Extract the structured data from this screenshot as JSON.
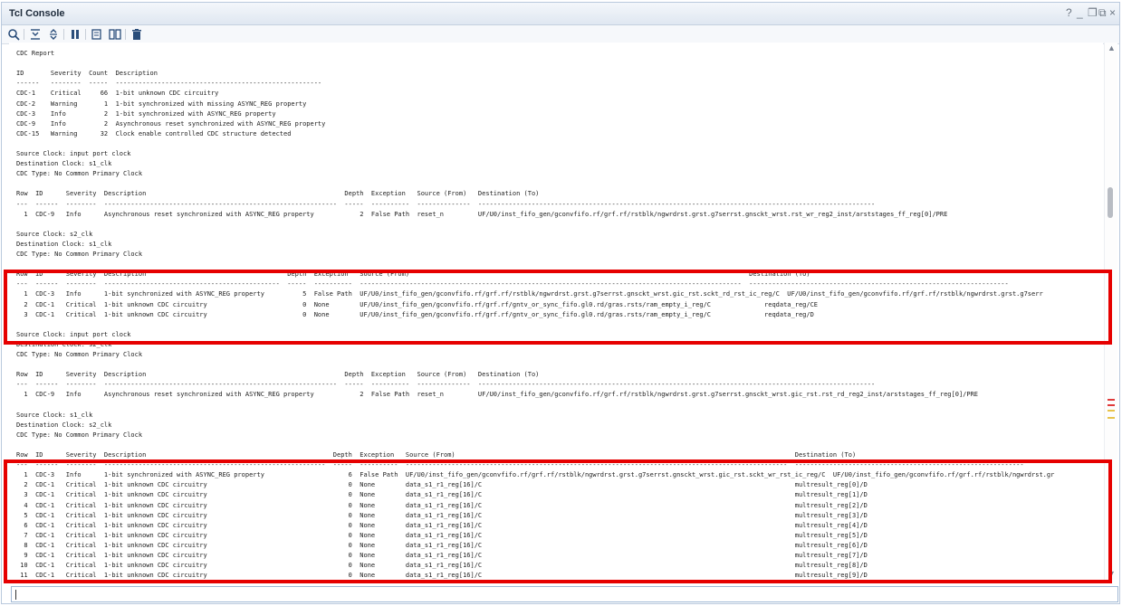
{
  "window": {
    "title": "Tcl Console",
    "controls": [
      "?",
      "_",
      "❐",
      "⧉",
      "×"
    ]
  },
  "toolbar": {
    "buttons": [
      {
        "icon": "search-icon"
      },
      {
        "icon": "collapse-all-icon"
      },
      {
        "icon": "expand-all-icon"
      },
      {
        "icon": "pause-icon"
      },
      {
        "icon": "copy-icon"
      },
      {
        "icon": "columns-icon"
      },
      {
        "icon": "delete-icon"
      }
    ]
  },
  "console": {
    "lines": [
      "CDC Report",
      "",
      "ID       Severity  Count  Description",
      "------   --------  -----  ------------------------------------------------------",
      "CDC-1    Critical     66  1-bit unknown CDC circuitry",
      "CDC-2    Warning       1  1-bit synchronized with missing ASYNC_REG property",
      "CDC-3    Info          2  1-bit synchronized with ASYNC_REG property",
      "CDC-9    Info          2  Asynchronous reset synchronized with ASYNC_REG property",
      "CDC-15   Warning      32  Clock enable controlled CDC structure detected",
      "",
      "Source Clock: input port clock",
      "Destination Clock: s1_clk",
      "CDC Type: No Common Primary Clock",
      "",
      "Row  ID      Severity  Description                                                    Depth  Exception   Source (From)   Destination (To)",
      "---  ------  --------  -------------------------------------------------------------  -----  ----------  --------------  --------------------------------------------------------------------------------------------------------",
      "  1  CDC-9   Info      Asynchronous reset synchronized with ASYNC_REG property            2  False Path  reset_n         UF/U0/inst_fifo_gen/gconvfifo.rf/grf.rf/rstblk/ngwrdrst.grst.g7serrst.gnsckt_wrst.rst_wr_reg2_inst/arststages_ff_reg[0]/PRE",
      "",
      "Source Clock: s2_clk",
      "Destination Clock: s1_clk",
      "CDC Type: No Common Primary Clock",
      "",
      "Row  ID      Severity  Description                                     Depth  Exception   Source (From)                                                                                         Destination (To)",
      "---  ------  --------  ----------------------------------------------  -----  ----------  ----------------------------------------------------------------------------------------------------  --------------------------------------------------------------------",
      "  1  CDC-3   Info      1-bit synchronized with ASYNC_REG property          5  False Path  UF/U0/inst_fifo_gen/gconvfifo.rf/grf.rf/rstblk/ngwrdrst.grst.g7serrst.gnsckt_wrst.gic_rst.sckt_rd_rst_ic_reg/C  UF/U0/inst_fifo_gen/gconvfifo.rf/grf.rf/rstblk/ngwrdrst.grst.g7serr",
      "  2  CDC-1   Critical  1-bit unknown CDC circuitry                         0  None        UF/U0/inst_fifo_gen/gconvfifo.rf/grf.rf/gntv_or_sync_fifo.gl0.rd/gras.rsts/ram_empty_i_reg/C              reqdata_reg/CE",
      "  3  CDC-1   Critical  1-bit unknown CDC circuitry                         0  None        UF/U0/inst_fifo_gen/gconvfifo.rf/grf.rf/gntv_or_sync_fifo.gl0.rd/gras.rsts/ram_empty_i_reg/C              reqdata_reg/D",
      "",
      "Source Clock: input port clock",
      "Destination Clock: s2_clk",
      "CDC Type: No Common Primary Clock",
      "",
      "Row  ID      Severity  Description                                                    Depth  Exception   Source (From)   Destination (To)",
      "---  ------  --------  -------------------------------------------------------------  -----  ----------  --------------  --------------------------------------------------------------------------------------------------------",
      "  1  CDC-9   Info      Asynchronous reset synchronized with ASYNC_REG property            2  False Path  reset_n         UF/U0/inst_fifo_gen/gconvfifo.rf/grf.rf/rstblk/ngwrdrst.grst.g7serrst.gnsckt_wrst.gic_rst.rst_rd_reg2_inst/arststages_ff_reg[0]/PRE",
      "",
      "Source Clock: s1_clk",
      "Destination Clock: s2_clk",
      "CDC Type: No Common Primary Clock",
      "",
      "Row  ID      Severity  Description                                                 Depth  Exception   Source (From)                                                                                         Destination (To)",
      "---  ------  --------  ----------------------------------------------------------  -----  ----------  ----------------------------------------------------------------------------------------------------  ------------------------------------------------------------",
      "  1  CDC-3   Info      1-bit synchronized with ASYNC_REG property                      6  False Path  UF/U0/inst_fifo_gen/gconvfifo.rf/grf.rf/rstblk/ngwrdrst.grst.g7serrst.gnsckt_wrst.gic_rst.sckt_wr_rst_ic_reg/C  UF/U0/inst_fifo_gen/gconvfifo.rf/grf.rf/rstblk/ngwrdrst.gr",
      "  2  CDC-1   Critical  1-bit unknown CDC circuitry                                     0  None        data_s1_r1_reg[16]/C                                                                                  multresult_reg[0]/D",
      "  3  CDC-1   Critical  1-bit unknown CDC circuitry                                     0  None        data_s1_r1_reg[16]/C                                                                                  multresult_reg[1]/D",
      "  4  CDC-1   Critical  1-bit unknown CDC circuitry                                     0  None        data_s1_r1_reg[16]/C                                                                                  multresult_reg[2]/D",
      "  5  CDC-1   Critical  1-bit unknown CDC circuitry                                     0  None        data_s1_r1_reg[16]/C                                                                                  multresult_reg[3]/D",
      "  6  CDC-1   Critical  1-bit unknown CDC circuitry                                     0  None        data_s1_r1_reg[16]/C                                                                                  multresult_reg[4]/D",
      "  7  CDC-1   Critical  1-bit unknown CDC circuitry                                     0  None        data_s1_r1_reg[16]/C                                                                                  multresult_reg[5]/D",
      "  8  CDC-1   Critical  1-bit unknown CDC circuitry                                     0  None        data_s1_r1_reg[16]/C                                                                                  multresult_reg[6]/D",
      "  9  CDC-1   Critical  1-bit unknown CDC circuitry                                     0  None        data_s1_r1_reg[16]/C                                                                                  multresult_reg[7]/D",
      " 10  CDC-1   Critical  1-bit unknown CDC circuitry                                     0  None        data_s1_r1_reg[16]/C                                                                                  multresult_reg[8]/D",
      " 11  CDC-1   Critical  1-bit unknown CDC circuitry                                     0  None        data_s1_r1_reg[16]/C                                                                                  multresult_reg[9]/D"
    ]
  },
  "input": {
    "value": ""
  },
  "colors": {
    "highlight": "#e60000",
    "marker_red": "#e03a3a",
    "marker_yellow": "#e8c34a"
  }
}
